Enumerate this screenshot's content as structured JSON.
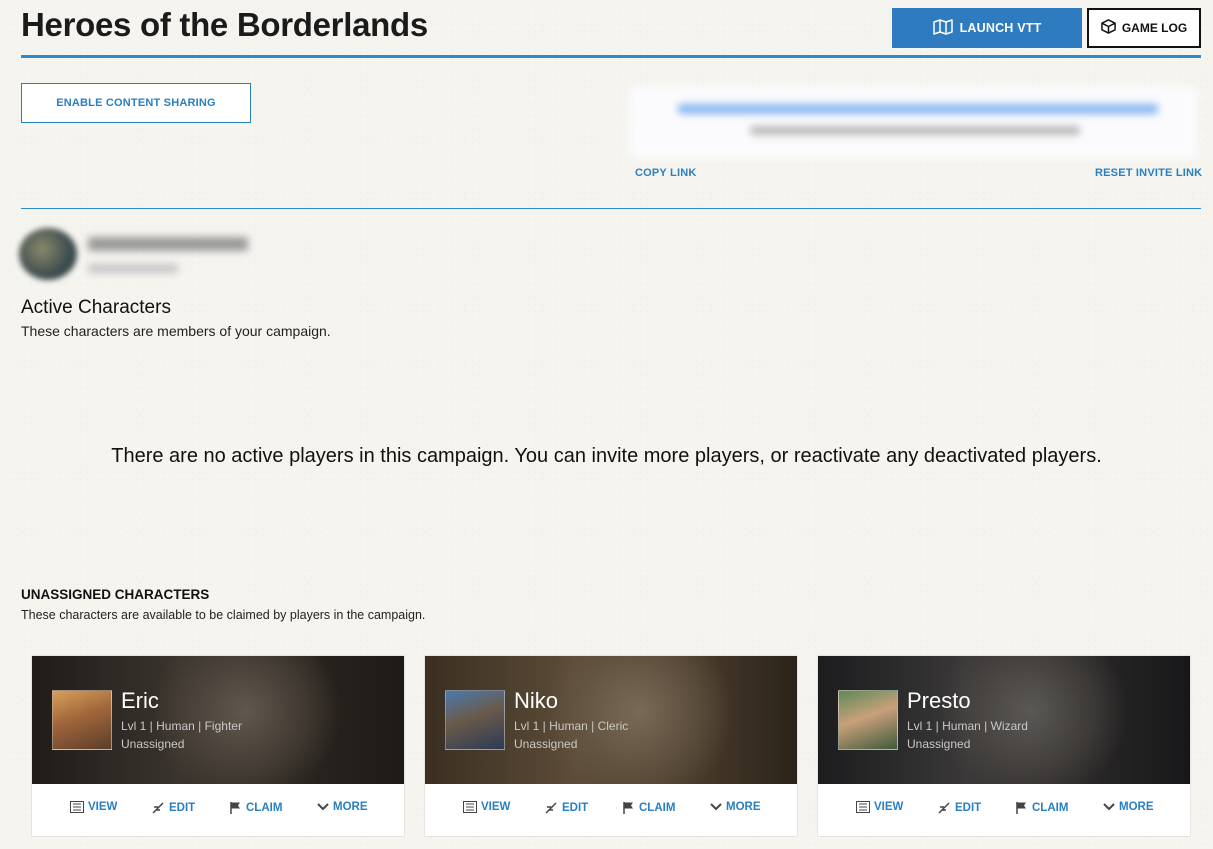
{
  "header": {
    "title": "Heroes of the Borderlands",
    "launch_vtt_label": "LAUNCH VTT",
    "game_log_label": "GAME LOG"
  },
  "sharing": {
    "enable_label": "ENABLE CONTENT SHARING",
    "copy_link_label": "COPY LINK",
    "reset_invite_label": "RESET INVITE LINK"
  },
  "active": {
    "title": "Active Characters",
    "subtitle": "These characters are members of your campaign.",
    "empty_message": "There are no active players in this campaign. You can invite more players, or reactivate any deactivated players."
  },
  "unassigned": {
    "title": "UNASSIGNED CHARACTERS",
    "subtitle": "These characters are available to be claimed by players in the campaign.",
    "characters": [
      {
        "name": "Eric",
        "meta": "Lvl 1 | Human | Fighter",
        "status": "Unassigned"
      },
      {
        "name": "Niko",
        "meta": "Lvl 1 | Human | Cleric",
        "status": "Unassigned"
      },
      {
        "name": "Presto",
        "meta": "Lvl 1 | Human | Wizard",
        "status": "Unassigned"
      }
    ],
    "actions": {
      "view": "VIEW",
      "edit": "EDIT",
      "claim": "CLAIM",
      "more": "MORE"
    }
  },
  "colors": {
    "accent": "#2a7fc0",
    "launch_button": "#2e7bbf",
    "divider": "#2a8ad2"
  },
  "icons": {
    "launch_vtt": "map-icon",
    "game_log": "cube-icon",
    "view": "sheet-icon",
    "edit": "quill-icon",
    "claim": "flag-icon",
    "more": "chevron-down-icon"
  }
}
